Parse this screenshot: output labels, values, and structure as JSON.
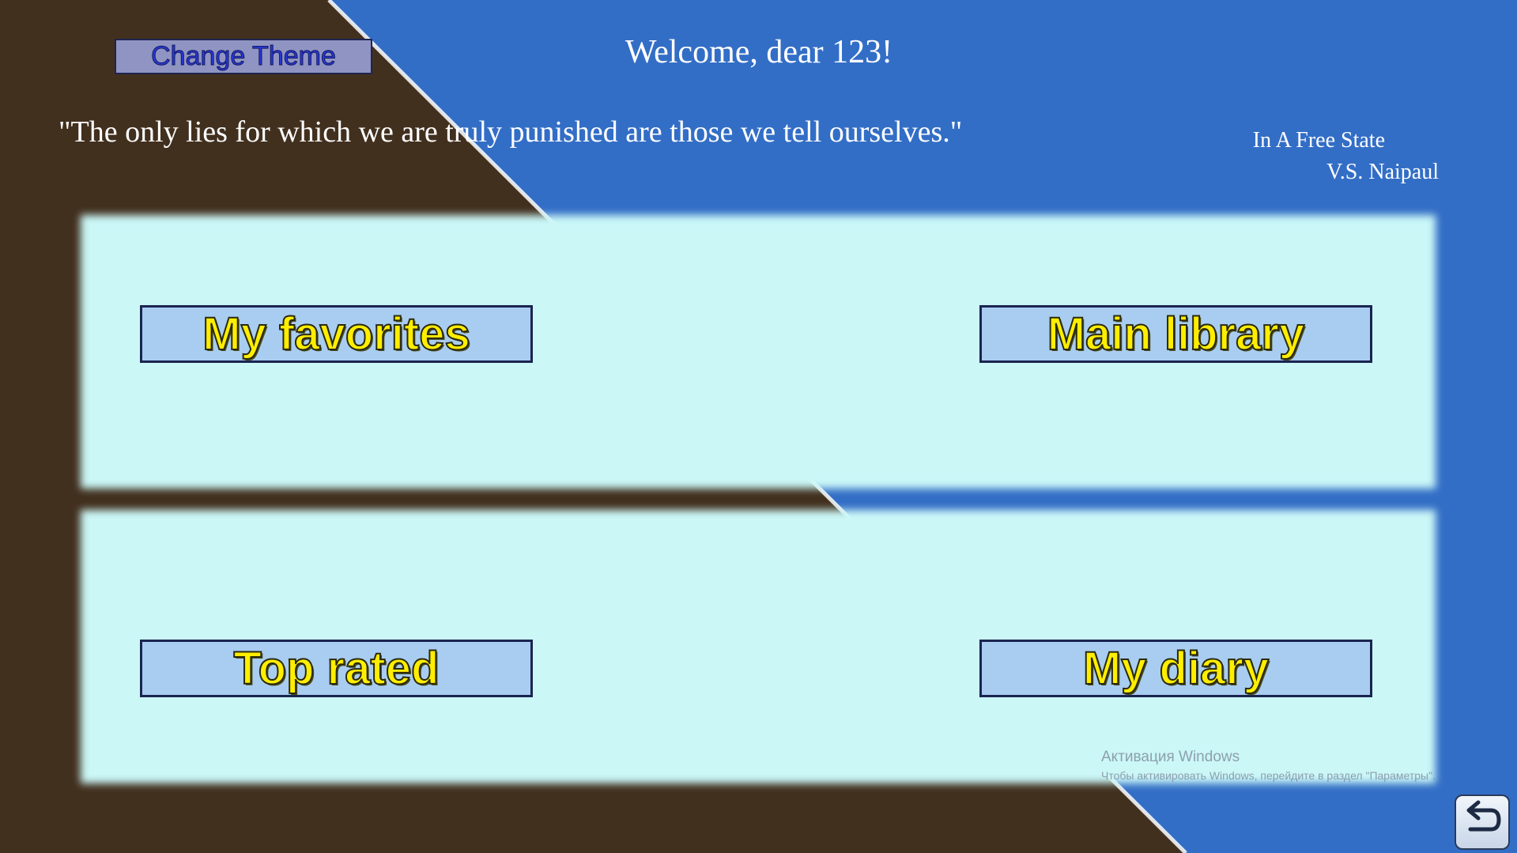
{
  "header": {
    "theme_button_label": "Change Theme",
    "welcome_text": "Welcome, dear 123!"
  },
  "quote": {
    "text": "\"The only lies for which we are truly punished are those we tell ourselves.\"",
    "book_title": "In A Free State",
    "author": "V.S. Naipaul"
  },
  "nav": {
    "favorites_label": "My favorites",
    "main_library_label": "Main library",
    "top_rated_label": "Top rated",
    "diary_label": "My diary"
  },
  "watermark": {
    "title": "Активация Windows",
    "subtitle": "Чтобы активировать Windows, перейдите в раздел \"Параметры\"."
  },
  "icons": {
    "back": "back-arrow-icon"
  },
  "colors": {
    "dark_brown": "#42301f",
    "blue": "#336ec6",
    "panel": "#cbf7f7",
    "button_fill": "#a9cdf0",
    "button_text": "#ffee00"
  }
}
